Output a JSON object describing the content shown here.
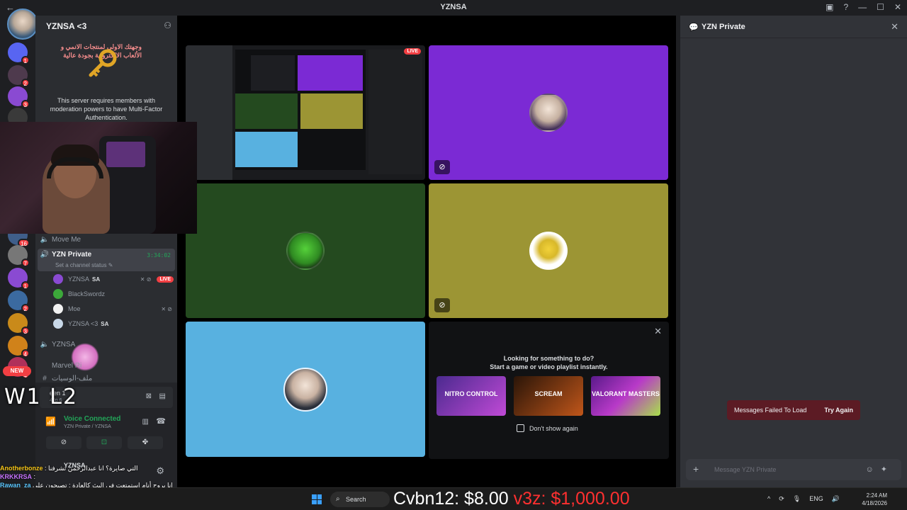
{
  "window": {
    "title": "YZNSA",
    "back_glyph": "←"
  },
  "colors": {
    "accent_green": "#23a559",
    "live_red": "#f23f43",
    "purple": "#7b2ad4",
    "olive": "#9c9534",
    "forest": "#244a1f",
    "sky": "#58b1e0"
  },
  "rail": {
    "new_label": "NEW",
    "servers": [
      {
        "badge": "1"
      },
      {
        "badge": "2"
      },
      {
        "badge": "3"
      },
      {
        "badge": ""
      },
      {
        "badge": "16"
      },
      {
        "badge": "7"
      },
      {
        "badge": "1"
      },
      {
        "badge": "2"
      },
      {
        "badge": "3"
      },
      {
        "badge": "4"
      },
      {
        "badge": "4"
      }
    ]
  },
  "guild": {
    "name": "YZNSA <3",
    "banner_ar": "وجهتك الاولى لمنتجات الانمي و الألعاب الالكترونية بجودة عالية",
    "mfa_message": "This server requires members with moderation powers to have Multi-Factor Authentication."
  },
  "channels": {
    "move_me": "Move Me",
    "active": {
      "name": "YZN Private",
      "timer": "3:34:02",
      "status_hint": "Set a channel status ✎"
    },
    "members": [
      {
        "name": "YZNSA",
        "tag": "SA",
        "live": "LIVE",
        "mic": "✕ ⊘"
      },
      {
        "name": "BlackSwordz",
        "tag": "",
        "live": "",
        "mic": ""
      },
      {
        "name": "Moe",
        "tag": "",
        "live": "",
        "mic": "✕ ⊘"
      },
      {
        "name": "YZNSA <3",
        "tag": "SA",
        "live": "",
        "mic": ""
      }
    ],
    "yznsa_channel": "YZNSA",
    "marvel": "Marvel Ri",
    "arabic_channel": "ملف-الوسيات"
  },
  "voice": {
    "status": "Voice Connected",
    "location": "YZN Private / YZNSA",
    "screen_label": "een 1",
    "screen_sub": "40p 6"
  },
  "userbar": {
    "name": "YZNSA"
  },
  "stage": {
    "live_badge": "LIVE"
  },
  "activity": {
    "title_line1": "Looking for something to do?",
    "title_line2": "Start a game or video playlist instantly.",
    "cards": [
      "NITRO CONTROL",
      "SCREAM",
      "VALORANT MASTERS"
    ],
    "dont_show": "Don't show again",
    "close_glyph": "✕"
  },
  "chat": {
    "channel": "YZN Private",
    "error": "Messages Failed To Load",
    "retry": "Try Again",
    "placeholder": "Message YZN Private"
  },
  "overlay": {
    "score": "W1  L2",
    "chat": [
      {
        "user": "Anotherbonze",
        "text": "التي صايرة؟ انا عبدالرحمن تشرفنا :"
      },
      {
        "user": "KRKKRSA",
        "text": ":"
      },
      {
        "user": "Rawan_za",
        "text": "انا بروح أنام استمتعت في البث كالعادة : تصبحون على خير جميعا"
      }
    ]
  },
  "taskbar": {
    "search": "Search",
    "ticker_white": "Cvbn12: $8.00",
    "ticker_red": "v3z: $1,000.00",
    "lang": "ENG",
    "time": "2:24 AM",
    "date": "4/18/2026"
  }
}
